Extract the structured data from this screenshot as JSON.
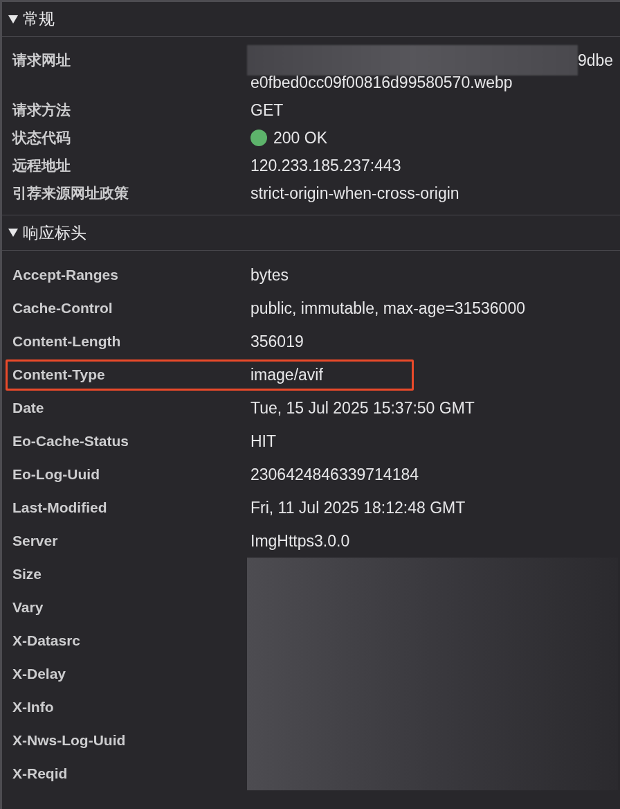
{
  "general": {
    "title": "常规",
    "expanded": true,
    "rows": [
      {
        "kind": "text",
        "label": "请求网址",
        "redacted": true,
        "value_lines": [
          "9dbe",
          "e0fbed0cc09f00816d99580570.webp"
        ]
      },
      {
        "kind": "text",
        "label": "请求方法",
        "redacted": false,
        "value_lines": [
          "GET"
        ]
      },
      {
        "kind": "status",
        "label": "状态代码",
        "redacted": false,
        "color": "#5db36b",
        "value_lines": [
          "200 OK"
        ]
      },
      {
        "kind": "text",
        "label": "远程地址",
        "redacted": false,
        "value_lines": [
          "120.233.185.237:443"
        ]
      },
      {
        "kind": "text",
        "label": "引荐来源网址政策",
        "redacted": false,
        "value_lines": [
          "strict-origin-when-cross-origin"
        ]
      }
    ]
  },
  "response_headers": {
    "title": "响应标头",
    "expanded": true,
    "rows": [
      {
        "name": "Accept-Ranges",
        "value": "bytes",
        "redacted": false,
        "highlighted": false
      },
      {
        "name": "Cache-Control",
        "value": "public, immutable, max-age=31536000",
        "redacted": false,
        "highlighted": false
      },
      {
        "name": "Content-Length",
        "value": "356019",
        "redacted": false,
        "highlighted": false
      },
      {
        "name": "Content-Type",
        "value": "image/avif",
        "redacted": false,
        "highlighted": true
      },
      {
        "name": "Date",
        "value": "Tue, 15 Jul 2025 15:37:50 GMT",
        "redacted": false,
        "highlighted": false
      },
      {
        "name": "Eo-Cache-Status",
        "value": "HIT",
        "redacted": false,
        "highlighted": false
      },
      {
        "name": "Eo-Log-Uuid",
        "value": "2306424846339714184",
        "redacted": false,
        "highlighted": false
      },
      {
        "name": "Last-Modified",
        "value": "Fri, 11 Jul 2025 18:12:48 GMT",
        "redacted": false,
        "highlighted": false
      },
      {
        "name": "Server",
        "value": "ImgHttps3.0.0",
        "redacted": false,
        "highlighted": false
      },
      {
        "name": "Size",
        "redacted": true,
        "highlighted": false
      },
      {
        "name": "Vary",
        "redacted": true,
        "highlighted": false
      },
      {
        "name": "X-Datasrc",
        "redacted": true,
        "highlighted": false
      },
      {
        "name": "X-Delay",
        "redacted": true,
        "highlighted": false
      },
      {
        "name": "X-Info",
        "redacted": true,
        "highlighted": false
      },
      {
        "name": "X-Nws-Log-Uuid",
        "redacted": true,
        "highlighted": false
      },
      {
        "name": "X-Reqid",
        "redacted": true,
        "highlighted": false
      }
    ]
  }
}
